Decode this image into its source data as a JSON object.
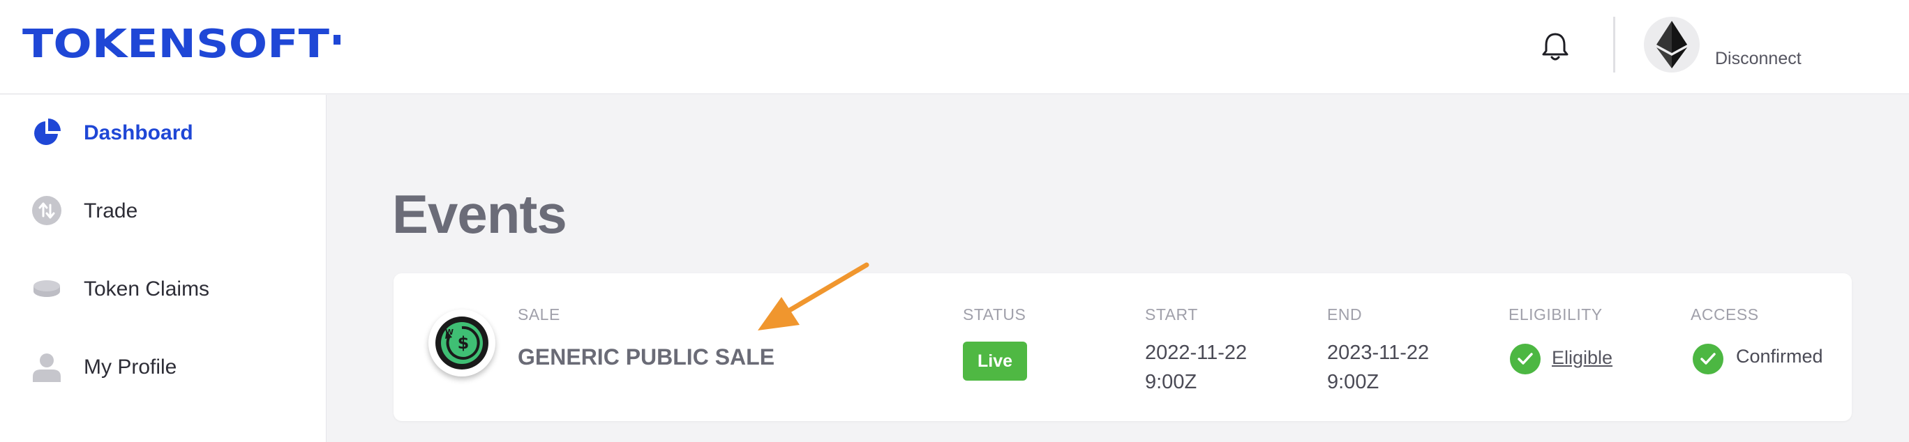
{
  "header": {
    "logo_text": "TOKENSOFT",
    "disconnect_label": "Disconnect"
  },
  "sidebar": {
    "items": [
      {
        "label": "Dashboard",
        "icon": "pie-chart-icon",
        "active": true
      },
      {
        "label": "Trade",
        "icon": "trade-arrows-icon",
        "active": false
      },
      {
        "label": "Token Claims",
        "icon": "coin-stack-icon",
        "active": false
      },
      {
        "label": "My Profile",
        "icon": "user-icon",
        "active": false
      }
    ]
  },
  "main": {
    "title": "Events",
    "table": {
      "headers": {
        "sale": "SALE",
        "status": "STATUS",
        "start": "START",
        "end": "END",
        "eligibility": "ELIGIBILITY",
        "access": "ACCESS"
      },
      "row": {
        "sale_name": "GENERIC PUBLIC SALE",
        "status": "Live",
        "start_date": "2022-11-22",
        "start_time": "9:00Z",
        "end_date": "2023-11-22",
        "end_time": "9:00Z",
        "eligibility": "Eligible",
        "access": "Confirmed"
      }
    }
  },
  "colors": {
    "brand": "#1f47d6",
    "live": "#4fb843",
    "check": "#4cb742",
    "arrow": "#f0962e"
  }
}
